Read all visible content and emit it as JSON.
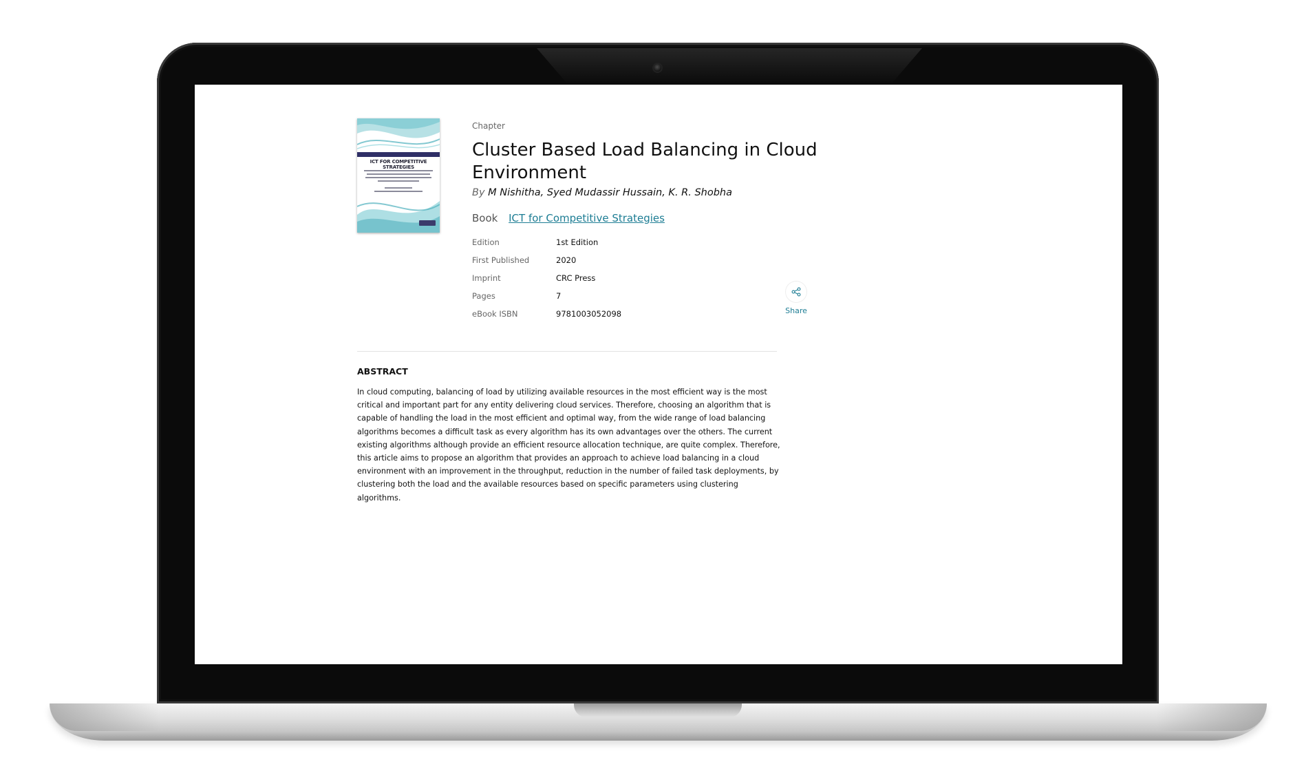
{
  "chapter": {
    "type_label": "Chapter",
    "title": "Cluster Based Load Balancing in Cloud Environment",
    "by": "By",
    "authors": "M Nishitha, Syed Mudassir Hussain, K. R. Shobha"
  },
  "book": {
    "label": "Book",
    "title": "ICT for Competitive Strategies",
    "cover_title": "ICT FOR COMPETITIVE STRATEGIES"
  },
  "details": [
    {
      "key": "Edition",
      "value": "1st Edition"
    },
    {
      "key": "First Published",
      "value": "2020"
    },
    {
      "key": "Imprint",
      "value": "CRC Press"
    },
    {
      "key": "Pages",
      "value": "7"
    },
    {
      "key": "eBook ISBN",
      "value": "9781003052098"
    }
  ],
  "share": {
    "label": "Share",
    "icon": "share-icon"
  },
  "abstract": {
    "heading": "ABSTRACT",
    "text": "In cloud computing, balancing of load by utilizing available resources in the most efficient way is the most critical and important part for any entity delivering cloud services. Therefore, choosing an algorithm that is capable of handling the load in the most efficient and optimal way, from the wide range of load balancing algorithms becomes a difficult task as every algorithm has its own advantages over the others. The current existing algorithms although provide an efficient resource allocation technique, are quite complex. Therefore, this article aims to propose an algorithm that provides an approach to achieve load balancing in a cloud environment with an improvement in the throughput, reduction in the number of failed task deployments, by clustering both the load and the available resources based on specific parameters using clustering algorithms."
  },
  "colors": {
    "link": "#1d7d94",
    "muted": "#666666",
    "bezel": "#0b0b0b"
  }
}
